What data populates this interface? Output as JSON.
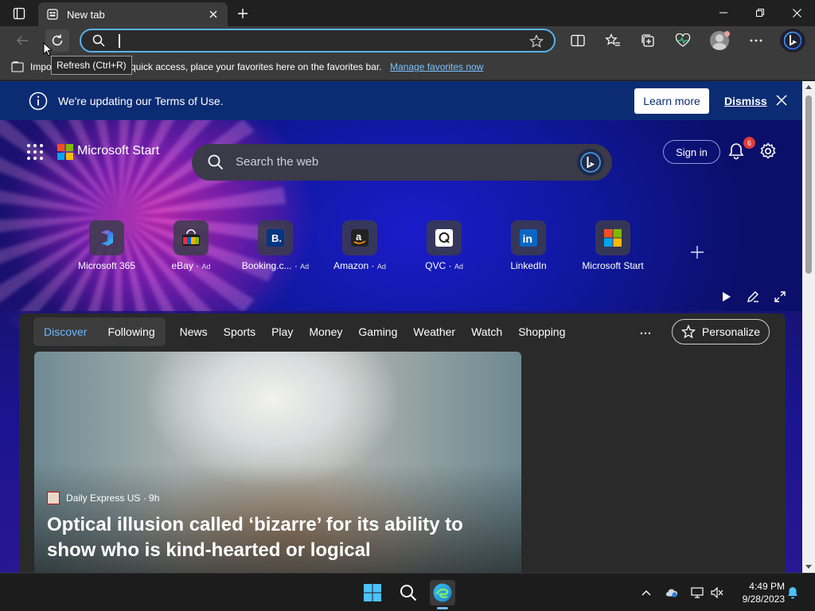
{
  "browser": {
    "tab": {
      "title": "New tab"
    },
    "address": {
      "value": "",
      "placeholder": ""
    },
    "tooltip": "Refresh (Ctrl+R)",
    "favorites_bar": {
      "text_start": "Impo",
      "text_end": "quick access, place your favorites here on the favorites bar.",
      "link": "Manage favorites now"
    }
  },
  "notice": {
    "text": "We're updating our Terms of Use.",
    "learn_more": "Learn more",
    "dismiss": "Dismiss"
  },
  "start": {
    "brand": "Microsoft Start",
    "search_placeholder": "Search the web",
    "sign_in": "Sign in",
    "notification_count": "6",
    "tiles": [
      {
        "label": "Microsoft 365",
        "ad": "",
        "icon": "microsoft-365-icon"
      },
      {
        "label": "eBay",
        "ad": "Ad",
        "icon": "ebay-icon"
      },
      {
        "label": "Booking.c...",
        "ad": "Ad",
        "icon": "booking-icon"
      },
      {
        "label": "Amazon",
        "ad": "Ad",
        "icon": "amazon-icon"
      },
      {
        "label": "QVC",
        "ad": "Ad",
        "icon": "qvc-icon"
      },
      {
        "label": "LinkedIn",
        "ad": "",
        "icon": "linkedin-icon"
      },
      {
        "label": "Microsoft Start",
        "ad": "",
        "icon": "microsoft-start-icon"
      }
    ]
  },
  "feed": {
    "pill": [
      "Discover",
      "Following"
    ],
    "nav": [
      "News",
      "Sports",
      "Play",
      "Money",
      "Gaming",
      "Weather",
      "Watch",
      "Shopping"
    ],
    "more": "···",
    "personalize": "Personalize",
    "card": {
      "source": "Daily Express US · 9h",
      "headline": "Optical illusion called ‘bizarre’ for its ability to show who is kind-hearted or logical"
    }
  },
  "taskbar": {
    "time": "4:49 PM",
    "date": "9/28/2023"
  },
  "colors": {
    "accent": "#5ab1f0",
    "banner": "#0b2c73",
    "link": "#7cc2ff",
    "badge": "#e03b3b"
  }
}
